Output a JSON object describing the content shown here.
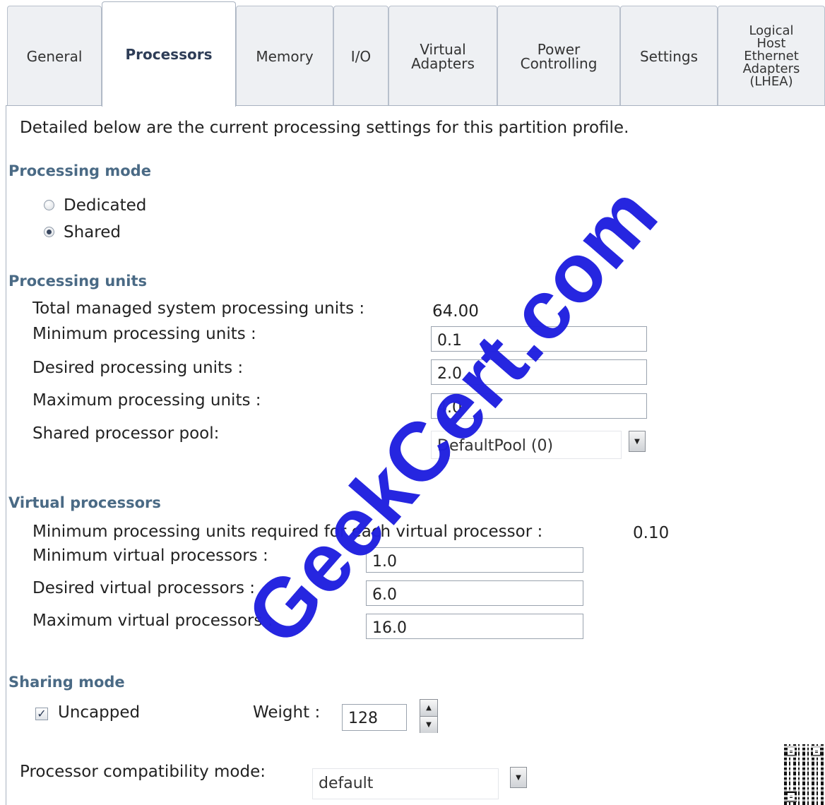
{
  "tabs": [
    {
      "label": "General"
    },
    {
      "label": "Processors"
    },
    {
      "label": "Memory"
    },
    {
      "label": "I/O"
    },
    {
      "label": "Virtual\nAdapters"
    },
    {
      "label": "Power\nControlling"
    },
    {
      "label": "Settings"
    },
    {
      "label": "Logical\nHost\nEthernet\nAdapters\n(LHEA)"
    }
  ],
  "active_tab": "Processors",
  "intro": "Detailed below are the current processing settings for this partition profile.",
  "processing_mode": {
    "heading": "Processing mode",
    "dedicated_label": "Dedicated",
    "shared_label": "Shared",
    "selected": "Shared"
  },
  "processing_units": {
    "heading": "Processing units",
    "total_label": "Total managed system processing units :",
    "total_value": "64.00",
    "min_label": "Minimum processing units :",
    "min_value": "0.1",
    "desired_label": "Desired processing units :",
    "desired_value": "2.0",
    "max_label": "Maximum processing units :",
    "max_value": "4.0",
    "pool_label": "Shared processor pool:",
    "pool_value": "DefaultPool (0)"
  },
  "virtual_processors": {
    "heading": "Virtual processors",
    "required_label": "Minimum processing units required for each virtual processor :",
    "required_value": "0.10",
    "min_label": "Minimum virtual processors :",
    "min_value": "1.0",
    "desired_label": "Desired virtual processors :",
    "desired_value": "6.0",
    "max_label": "Maximum virtual processors :",
    "max_value": "16.0"
  },
  "sharing_mode": {
    "heading": "Sharing mode",
    "uncapped_label": "Uncapped",
    "uncapped_checked": true,
    "weight_label": "Weight :",
    "weight_value": "128"
  },
  "compatibility": {
    "label": "Processor compatibility mode:",
    "value": "default"
  },
  "watermark": "GeekCert.com",
  "icons": {
    "dropdown": "chevron-down-icon",
    "spin_up": "chevron-up-icon",
    "spin_down": "chevron-down-icon",
    "qr": "qr-code-icon"
  },
  "colors": {
    "section_heading": "#4a6a85",
    "tab_bg": "#eef0f3",
    "active_tab_text": "#2e3d57",
    "watermark": "#2020e0"
  }
}
